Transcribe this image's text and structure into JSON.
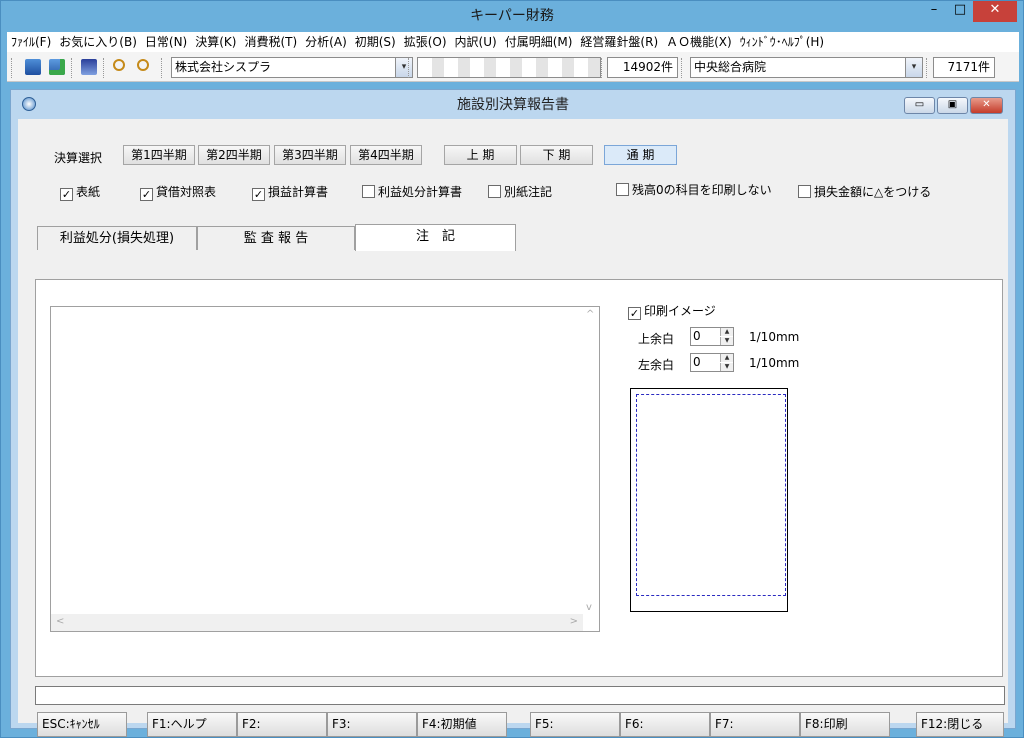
{
  "app": {
    "title": "キーパー財務",
    "min_label": "–",
    "max_label": "□",
    "close_label": "✕"
  },
  "menu": [
    "ﾌｧｲﾙ(F)",
    "お気に入り(B)",
    "日常(N)",
    "決算(K)",
    "消費税(T)",
    "分析(A)",
    "初期(S)",
    "拡張(O)",
    "内訳(U)",
    "付属明細(M)",
    "経営羅針盤(R)",
    "ＡＯ機能(X)",
    "ｳｨﾝﾄﾞｳ･ﾍﾙﾌﾟ(H)"
  ],
  "toolbar": {
    "company": "株式会社シスプラ",
    "hidden_field": "",
    "count1": "14902件",
    "hospital": "中央総合病院",
    "count2": "7171件",
    "dropdown_arrow": "▾",
    "icons": [
      "monitor-icon",
      "monitor-add-icon",
      "image-icon",
      "zoom-in-icon",
      "zoom-out-icon"
    ]
  },
  "child": {
    "title": "施設別決算報告書",
    "min_label": "▭",
    "max_label": "▣",
    "close_label": "✕"
  },
  "kessan": {
    "label": "決算選択",
    "buttons": [
      "第1四半期",
      "第2四半期",
      "第3四半期",
      "第4四半期",
      "上 期",
      "下 期",
      "通 期"
    ],
    "selected": "通 期"
  },
  "checks": [
    {
      "label": "表紙",
      "checked": true
    },
    {
      "label": "貸借対照表",
      "checked": true
    },
    {
      "label": "損益計算書",
      "checked": true
    },
    {
      "label": "利益処分計算書",
      "checked": false
    },
    {
      "label": "別紙注記",
      "checked": false
    },
    {
      "label": "残高0の科目を印刷しない",
      "checked": false
    },
    {
      "label": "損失金額に△をつける",
      "checked": false
    }
  ],
  "tabs": [
    "利益処分(損失処理)",
    "監 査 報 告",
    "注　記"
  ],
  "active_tab": "注　記",
  "print": {
    "label": "印刷イメージ",
    "checked": true,
    "top_margin_label": "上余白",
    "top_margin_value": "0",
    "left_margin_label": "左余白",
    "left_margin_value": "0",
    "unit": "1/10mm"
  },
  "scroll": {
    "up": "^",
    "down": "v",
    "left": "<",
    "right": ">"
  },
  "fkeys": [
    "ESC:ｷｬﾝｾﾙ",
    "F1:ヘルプ",
    "F2:",
    "F3:",
    "F4:初期値",
    "F5:",
    "F6:",
    "F7:",
    "F8:印刷",
    "F12:閉じる"
  ],
  "check_mark": "✓"
}
